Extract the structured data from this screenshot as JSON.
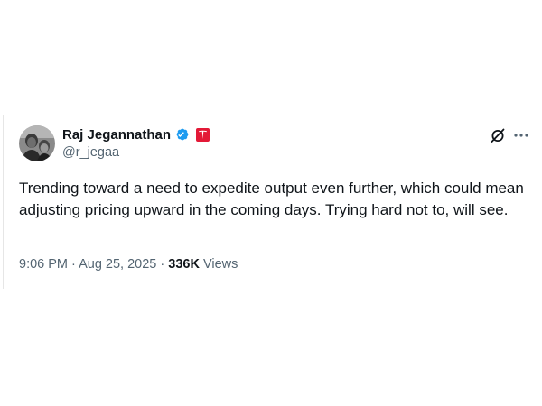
{
  "tweet": {
    "author": {
      "display_name": "Raj Jegannathan",
      "handle": "@r_jegaa",
      "verified": true,
      "affiliate_badge": "tesla-logo",
      "affiliate_color": "#e31937",
      "verified_color": "#1d9bf0"
    },
    "text": "Trending toward a need to expedite output even further, which could mean adjusting pricing upward in the coming days. Trying hard not to, will see.",
    "timestamp": "9:06 PM · Aug 25, 2025",
    "separator": " · ",
    "views_count": "336K",
    "views_label": " Views",
    "icons": {
      "grok": "grok-icon",
      "more": "more-options-icon"
    }
  }
}
